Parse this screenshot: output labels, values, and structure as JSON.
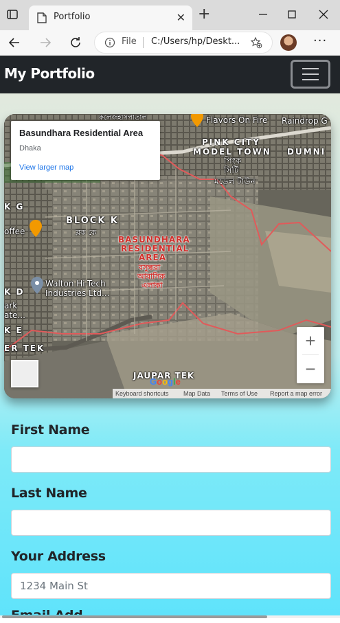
{
  "browser": {
    "tab_title": "Portfolio",
    "address_scheme": "File",
    "address_url": "C:/Users/hp/Deskt..."
  },
  "navbar": {
    "brand": "My Portfolio"
  },
  "map": {
    "info_card": {
      "title": "Basundhara Residential Area",
      "subtitle": "Dhaka",
      "link": "View larger map"
    },
    "labels": {
      "flavors": "Flavors On Fire",
      "raindrop": "Raindrop G",
      "pink_city": "PINK CITY",
      "model_town": "MODEL TOWN",
      "dumni": "DUMNI",
      "pink_bn1": "পিংক",
      "pink_bn2": "সিটি",
      "pink_bn3": "মডেল টাউন",
      "block_k": "BLOCK K",
      "block_k_bn": "ব্লক কে",
      "block_g": "K G",
      "coffee": "offee",
      "basundhara1": "BASUNDHARA",
      "basundhara2": "RESIDENTIAL",
      "basundhara3": "AREA",
      "basundhara_bn1": "বসুন্ধরা",
      "basundhara_bn2": "আবাসিক",
      "basundhara_bn3": "এলাকা",
      "walton1": "Walton Hi-Tech",
      "walton2": "Industries Ltd...",
      "k_d": "K D",
      "ark": "ark",
      "ate": "ate...",
      "k_e": "K E",
      "er_tek": "ER TEK",
      "jaupar": "JAUPAR TEK",
      "college_bn": "কলেজহাসপাতাল",
      "google": "Google"
    },
    "zoom_in": "+",
    "zoom_out": "−",
    "footer": {
      "shortcuts": "Keyboard shortcuts",
      "map_data": "Map Data",
      "terms": "Terms of Use",
      "report": "Report a map error"
    }
  },
  "form": {
    "first_name_label": "First Name",
    "first_name_value": "",
    "last_name_label": "Last Name",
    "last_name_value": "",
    "address_label": "Your Address",
    "address_placeholder": "1234 Main St",
    "email_label": "Email Add"
  }
}
